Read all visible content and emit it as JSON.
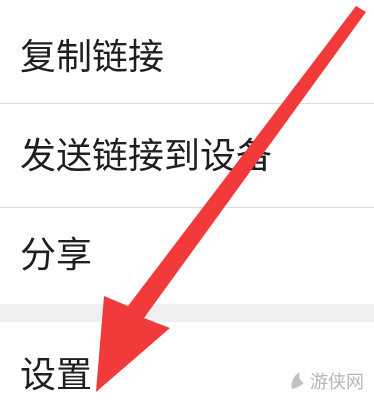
{
  "menu": {
    "items": [
      {
        "label": "复制链接"
      },
      {
        "label": "发送链接到设备"
      },
      {
        "label": "分享"
      },
      {
        "label": "设置"
      }
    ]
  },
  "watermark": {
    "text": "游侠网"
  },
  "colors": {
    "arrow": "#f23a3a",
    "item_background": "#ffffff",
    "divider": "#dcdcdc",
    "section_gap": "#efefef",
    "label_text": "#1f1f1f"
  }
}
